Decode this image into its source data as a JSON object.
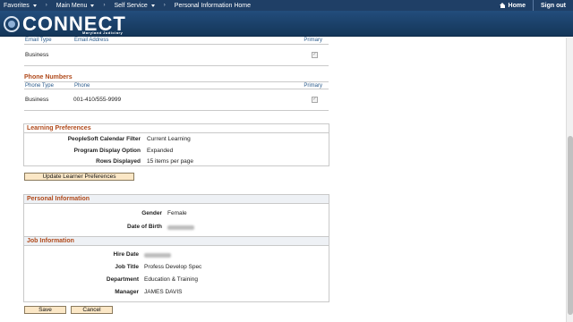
{
  "topnav": {
    "favorites": "Favorites",
    "main_menu": "Main Menu",
    "self_service": "Self Service",
    "current_page": "Personal Information Home",
    "home": "Home",
    "sign_out": "Sign out"
  },
  "banner": {
    "logo_text": "CONNECT",
    "logo_sub": "Maryland Judiciary"
  },
  "email": {
    "headers": [
      "Email Type",
      "Email Address",
      "Primary"
    ],
    "rows": [
      {
        "type": "Business",
        "address": "",
        "primary": true
      }
    ]
  },
  "phone": {
    "title": "Phone Numbers",
    "headers": [
      "Phone Type",
      "Phone",
      "Primary"
    ],
    "rows": [
      {
        "type": "Business",
        "phone": "001-410/555-9999",
        "primary": true
      }
    ]
  },
  "learning": {
    "title": "Learning Preferences",
    "fields": [
      {
        "label": "PeopleSoft Calendar Filter",
        "value": "Current Learning"
      },
      {
        "label": "Program Display Option",
        "value": "Expanded"
      },
      {
        "label": "Rows Displayed",
        "value": "15 items per page"
      }
    ],
    "update_button": "Update Learner Preferences"
  },
  "personal": {
    "title": "Personal Information",
    "gender_label": "Gender",
    "gender_value": "Female",
    "dob_label": "Date of Birth"
  },
  "job": {
    "title": "Job Information",
    "hire_date_label": "Hire Date",
    "job_title_label": "Job Title",
    "job_title_value": "Profess Develop Spec",
    "department_label": "Department",
    "department_value": "Education & Training",
    "manager_label": "Manager",
    "manager_value": "JAMES DAVIS"
  },
  "actions": {
    "save": "Save",
    "cancel": "Cancel"
  },
  "colors": {
    "nav_bg": "#1f3f66",
    "section_title": "#b0491a",
    "header_text": "#2b5b8c",
    "button_bg": "#fbe7c6"
  }
}
